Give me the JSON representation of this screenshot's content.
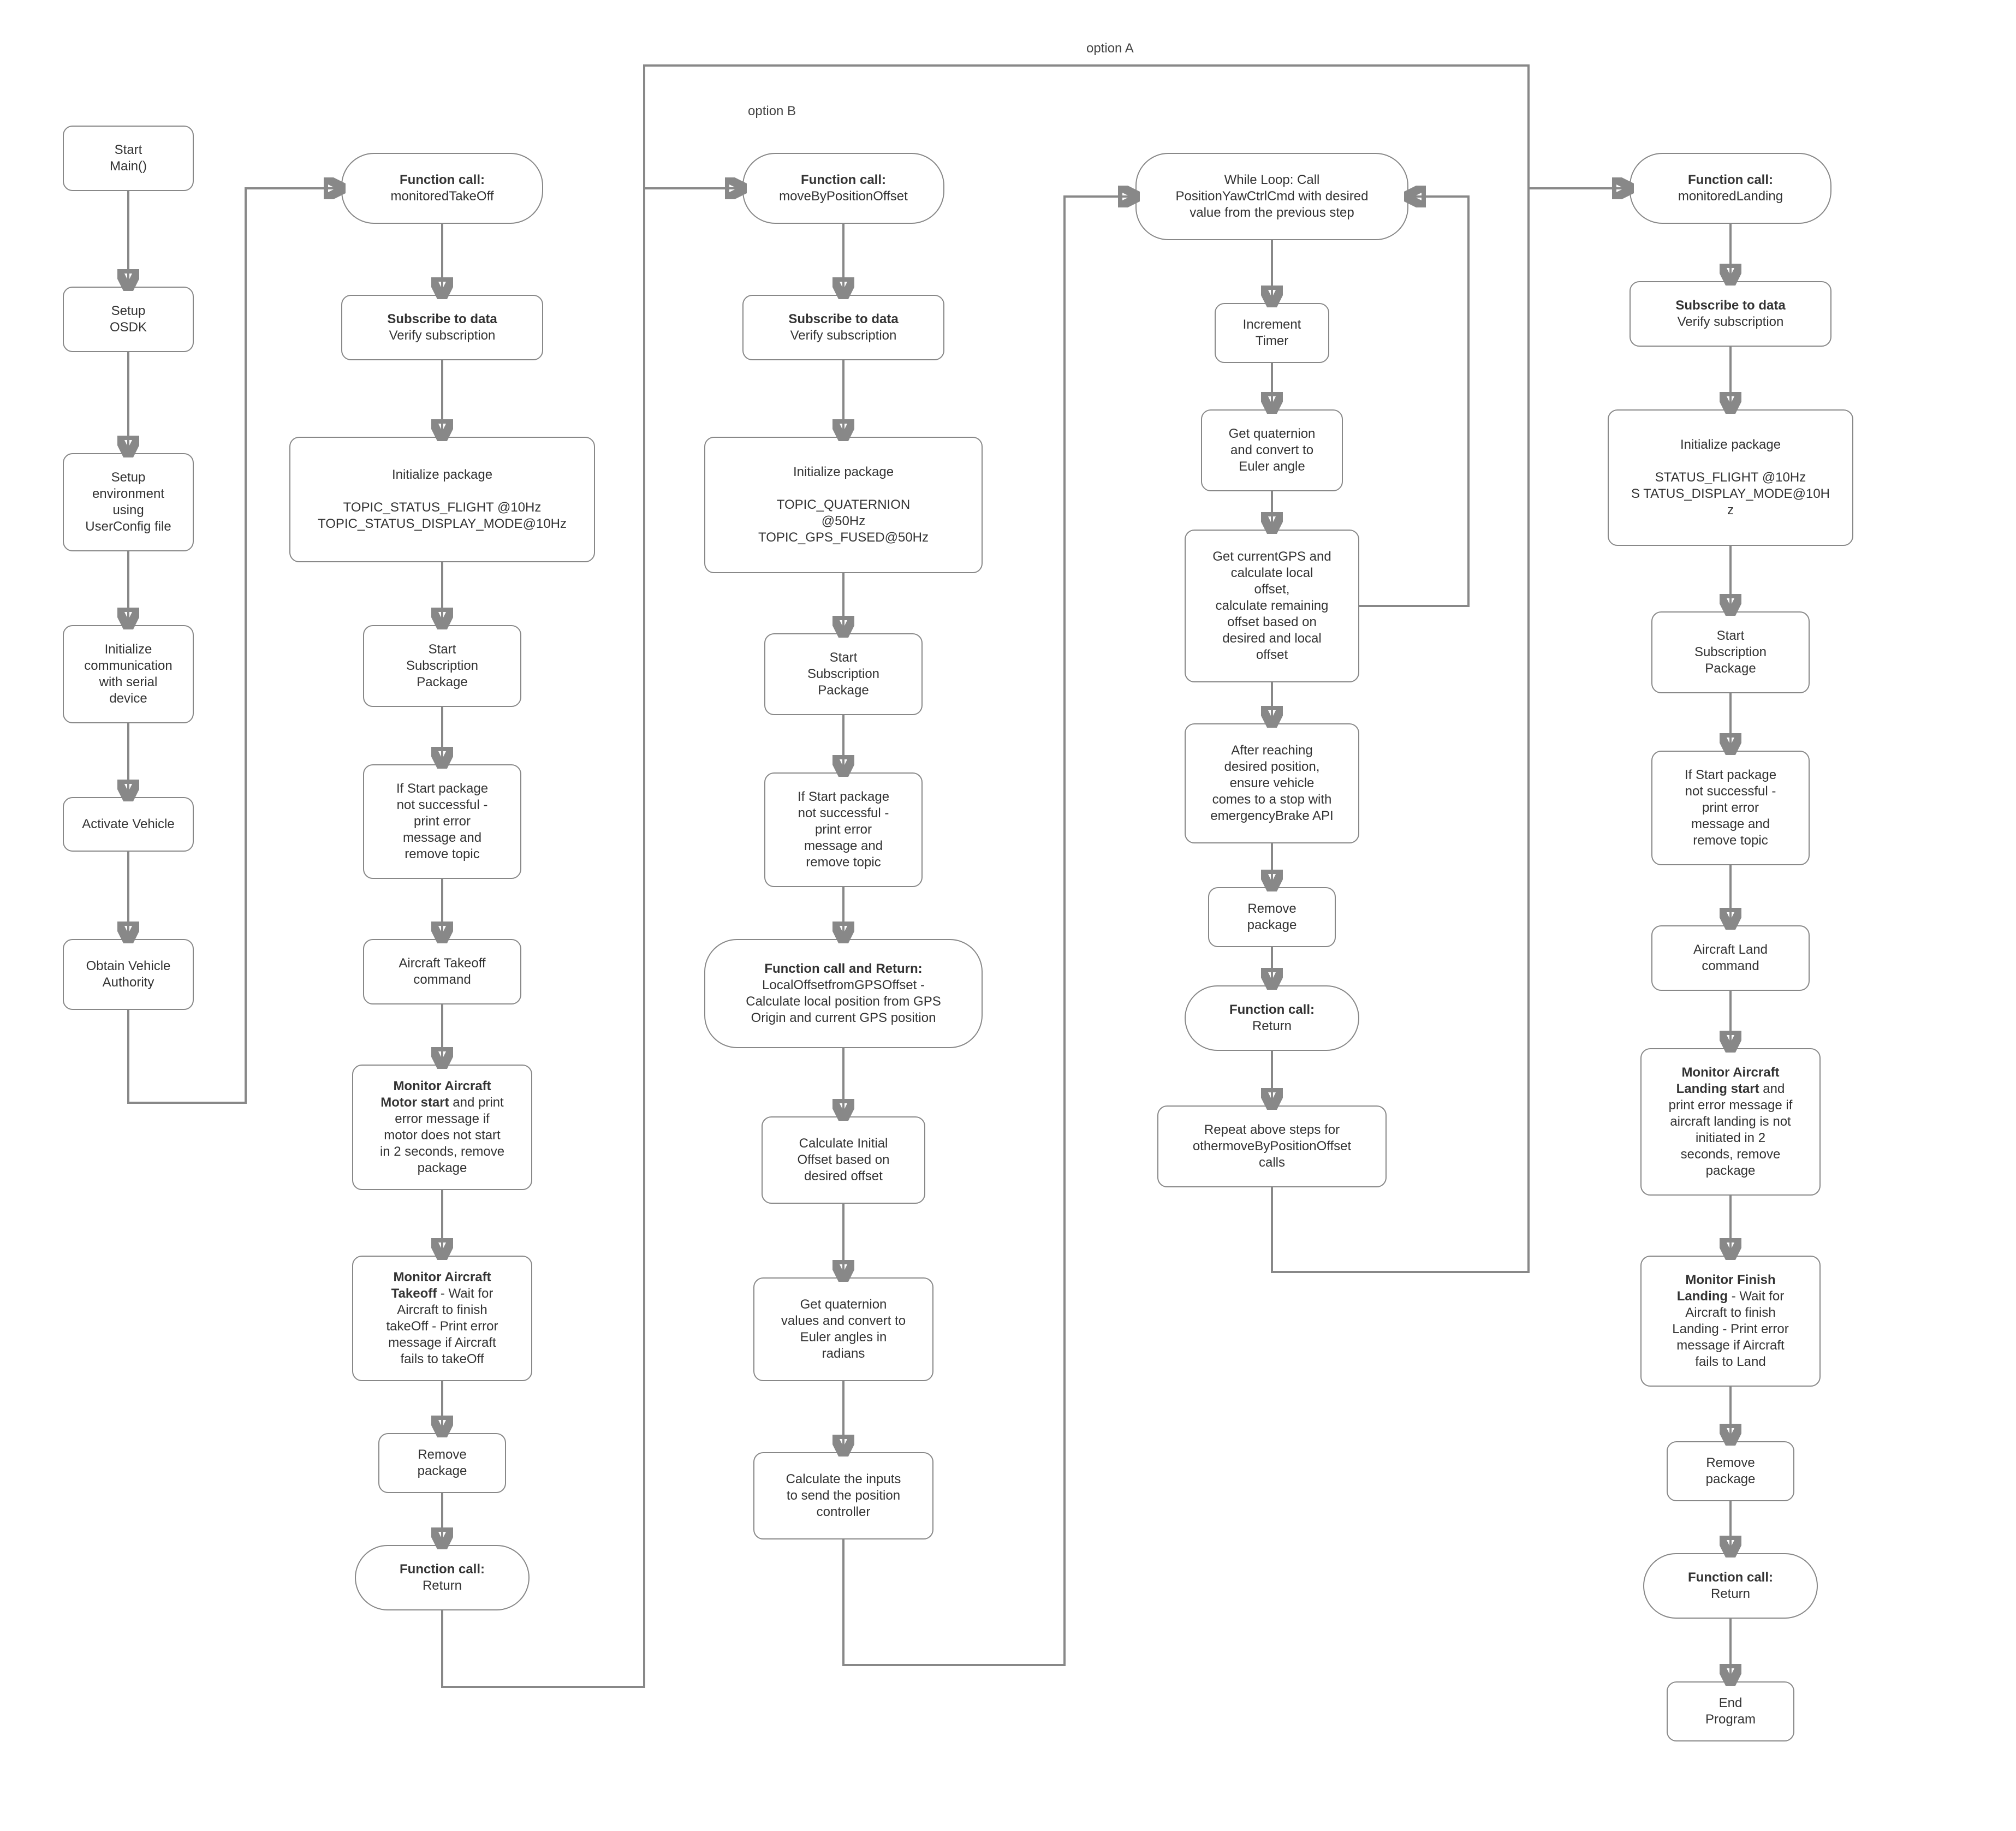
{
  "annotations": {
    "option_a": "option A",
    "option_b": "option B"
  },
  "col1": {
    "start": "Start\nMain()",
    "setup_osdk": "Setup\nOSDK",
    "setup_env": "Setup\nenvironment\nusing\nUserConfig file",
    "init_comm": "Initialize\ncommunication\nwith serial\ndevice",
    "activate": "Activate Vehicle",
    "obtain_auth": "Obtain Vehicle\nAuthority"
  },
  "col2": {
    "func": "Function call:",
    "func_name": "monitoredTakeOff",
    "sub_bold": "Subscribe to data",
    "sub_text": "Verify subscription",
    "init_pkg": "Initialize package\n\nTOPIC_STATUS_FLIGHT @10Hz\nTOPIC_STATUS_DISPLAY_MODE@10Hz",
    "start_sub": "Start\nSubscription\nPackage",
    "if_start": "If Start package\nnot successful -\nprint error\nmessage and\nremove topic",
    "takeoff_cmd": "Aircraft Takeoff\ncommand",
    "monitor_motor_bold": "Monitor Aircraft\nMotor start",
    "monitor_motor_rest": " and print\nerror message if\nmotor does not start\nin 2 seconds, remove\npackage",
    "monitor_takeoff_bold": "Monitor Aircraft\nTakeoff",
    "monitor_takeoff_rest": " - Wait for\nAircraft to finish\ntakeOff - Print error\nmessage if Aircraft\nfails to takeOff",
    "remove_pkg": "Remove\npackage",
    "return_bold": "Function call:",
    "return_text": "Return"
  },
  "col3": {
    "func": "Function call:",
    "func_name": "moveByPositionOffset",
    "sub_bold": "Subscribe to data",
    "sub_text": "Verify subscription",
    "init_pkg": "Initialize package\n\nTOPIC_QUATERNION\n@50Hz\nTOPIC_GPS_FUSED@50Hz",
    "start_sub": "Start\nSubscription\nPackage",
    "if_start": "If Start package\nnot successful -\nprint error\nmessage and\nremove topic",
    "local_offset_bold": "Function call and Return:",
    "local_offset_rest": "LocalOffsetfromGPSOffset -\nCalculate local position from GPS\nOrigin and current GPS position",
    "calc_init": "Calculate Initial\nOffset based on\ndesired offset",
    "get_quat": "Get quaternion\nvalues and convert to\nEuler angles in\nradians",
    "calc_inputs": "Calculate the inputs\nto send the position\ncontroller"
  },
  "col4": {
    "while_loop": "While Loop: Call\nPositionYawCtrlCmd with desired\nvalue from the previous step",
    "inc_timer": "Increment\nTimer",
    "get_quat_euler": "Get quaternion\nand convert to\nEuler angle",
    "get_gps": "Get currentGPS and\ncalculate local\noffset,\ncalculate remaining\noffset based on\ndesired and local\noffset",
    "after_reach": "After reaching\ndesired position,\nensure vehicle\ncomes to a stop with\nemergencyBrake API",
    "remove_pkg": "Remove\npackage",
    "return_bold": "Function call:",
    "return_text": "Return",
    "repeat": "Repeat above steps for\nothermoveByPositionOffset\ncalls"
  },
  "col5": {
    "func": "Function call:",
    "func_name": "monitoredLanding",
    "sub_bold": "Subscribe to data",
    "sub_text": "Verify subscription",
    "init_pkg": "Initialize package\n\nSTATUS_FLIGHT @10Hz\nS TATUS_DISPLAY_MODE@10H\nz",
    "start_sub": "Start\nSubscription\nPackage",
    "if_start": "If Start package\nnot successful -\nprint error\nmessage and\nremove topic",
    "land_cmd": "Aircraft Land\ncommand",
    "monitor_land_start_bold": "Monitor Aircraft\nLanding start",
    "monitor_land_start_rest": " and\nprint error message if\naircraft landing is not\ninitiated in 2\nseconds, remove\npackage",
    "monitor_finish_bold": "Monitor Finish\nLanding",
    "monitor_finish_rest": " - Wait for\nAircraft to finish\nLanding - Print error\nmessage if Aircraft\nfails to Land",
    "remove_pkg": "Remove\npackage",
    "return_bold": "Function call:",
    "return_text": "Return",
    "end": "End\nProgram"
  }
}
